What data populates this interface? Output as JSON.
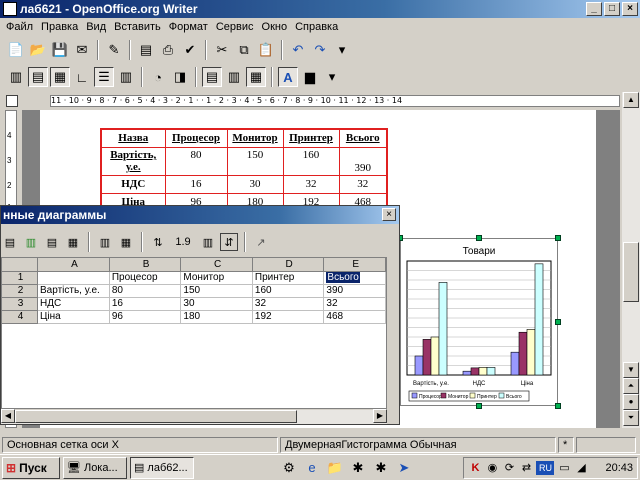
{
  "window": {
    "title": "лаб621 - OpenOffice.org Writer",
    "min": "_",
    "max": "□",
    "close": "×"
  },
  "menu": [
    "Файл",
    "Правка",
    "Вид",
    "Вставить",
    "Формат",
    "Сервис",
    "Окно",
    "Справка"
  ],
  "ruler": {
    "h": "11 · 10 · 9 · 8 · 7 · 6 · 5 · 4 · 3 · 2 · 1 ·  · 1 · 2 · 3 · 4 · 5 · 6 · 7 · 8 · 9 · 10 · 11 · 12 · 13 · 14",
    "v": [
      "4",
      "3",
      "2",
      "1"
    ]
  },
  "doc_table": {
    "header": [
      "Назва",
      "Процесор",
      "Монитор",
      "Принтер",
      "Всього"
    ],
    "rows": [
      [
        "Вартість, у.е.",
        "80",
        "150",
        "160",
        "390"
      ],
      [
        "НДС",
        "16",
        "30",
        "32",
        "32"
      ],
      [
        "Ціна",
        "96",
        "180",
        "192",
        "468"
      ]
    ]
  },
  "dialog": {
    "title": "нные диаграммы",
    "close": "×",
    "toolbar_text": "1.9",
    "grid": {
      "col_headers": [
        "",
        "A",
        "B",
        "C",
        "D",
        "E"
      ],
      "rows": [
        [
          "1",
          "",
          "Процесор",
          "Монитор",
          "Принтер",
          "Всього"
        ],
        [
          "2",
          "Вартість, у.е.",
          "80",
          "150",
          "160",
          "390"
        ],
        [
          "3",
          "НДС",
          "16",
          "30",
          "32",
          "32"
        ],
        [
          "4",
          "Ціна",
          "96",
          "180",
          "192",
          "468"
        ]
      ]
    }
  },
  "chart_data": {
    "type": "bar",
    "title": "Товари",
    "categories": [
      "Вартість, у.е.",
      "НДС",
      "Ціна"
    ],
    "series": [
      {
        "name": "Процесор",
        "values": [
          80,
          16,
          96
        ],
        "color": "#9999ff"
      },
      {
        "name": "Монитор",
        "values": [
          150,
          30,
          180
        ],
        "color": "#993366"
      },
      {
        "name": "Принтер",
        "values": [
          160,
          32,
          192
        ],
        "color": "#ffffcc"
      },
      {
        "name": "Всього",
        "values": [
          390,
          32,
          468
        ],
        "color": "#ccffff"
      }
    ],
    "ylim": [
      0,
      480
    ],
    "grid": true
  },
  "status": {
    "left": "Основная сетка оси X",
    "mid": "ДвумернаяГистограмма Обычная",
    "star": "*"
  },
  "taskbar": {
    "start": "Пуск",
    "tasks": [
      "Лока...",
      "лаб62..."
    ],
    "clock": "20:43",
    "lang": "RU"
  }
}
